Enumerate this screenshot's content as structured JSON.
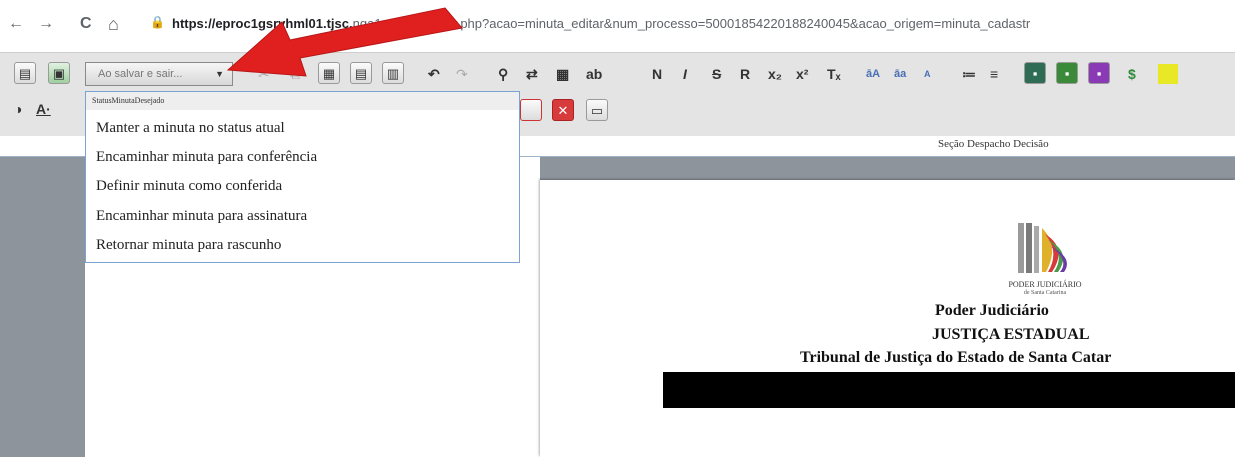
{
  "browser": {
    "back_icon": "←",
    "forward_icon": "→",
    "reload_icon": "C",
    "home_icon": "⌂",
    "url_host": "https://eproc1gsrvhml01.tjsc.",
    "url_path": "nga1g/controlador.php?acao=minuta_editar&num_processo=50001854220188240045&acao_origem=minuta_cadastr"
  },
  "toolbar": {
    "save_select_value": "Ao salvar e sair...",
    "format_bold": "N",
    "format_italic": "I",
    "format_strike": "S",
    "format_r": "R",
    "subscript": "x₂",
    "superscript": "x²",
    "clear_format": "Tₓ",
    "font_small": "A",
    "currency": "$"
  },
  "dropdown": {
    "header": "StatusMinutaDesejado",
    "items": [
      "Manter a minuta no status atual",
      "Encaminhar minuta para conferência",
      "Definir minuta como conferida",
      "Encaminhar minuta para assinatura",
      "Retornar minuta para rascunho"
    ]
  },
  "section": {
    "title": "Seção Despacho Decisão"
  },
  "document": {
    "logo_line1": "PODER JUDICIÁRIO",
    "logo_line2": "de Santa Catarina",
    "heading1": "Poder Judiciário",
    "heading2": "JUSTIÇA ESTADUAL",
    "heading3": "Tribunal de Justiça do Estado de Santa Catar"
  },
  "colors": {
    "arrow": "#e0201f",
    "dropdown_border": "#7aa3d4",
    "pane_gray": "#8e949c"
  }
}
